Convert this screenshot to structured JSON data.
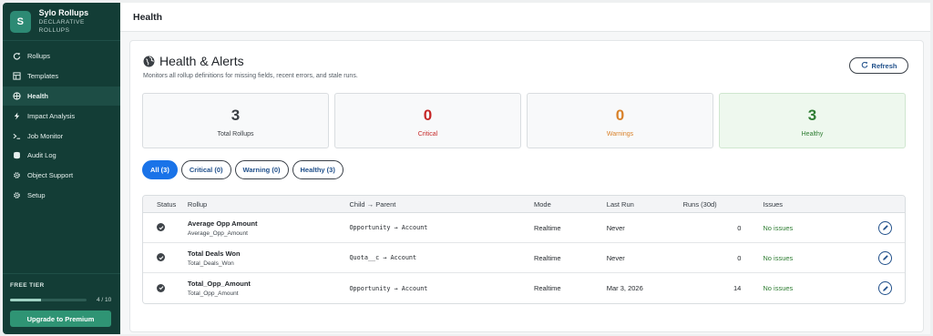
{
  "brand": {
    "logo_letter": "S",
    "name": "Sylo Rollups",
    "subtitle": "DECLARATIVE ROLLUPS"
  },
  "sidebar": {
    "items": [
      {
        "label": "Rollups",
        "icon": "refresh-icon",
        "active": false
      },
      {
        "label": "Templates",
        "icon": "template-icon",
        "active": false
      },
      {
        "label": "Health",
        "icon": "health-icon",
        "active": true
      },
      {
        "label": "Impact Analysis",
        "icon": "bolt-icon",
        "active": false
      },
      {
        "label": "Job Monitor",
        "icon": "terminal-icon",
        "active": false
      },
      {
        "label": "Audit Log",
        "icon": "database-icon",
        "active": false
      },
      {
        "label": "Object Support",
        "icon": "gear-icon",
        "active": false
      },
      {
        "label": "Setup",
        "icon": "gear-icon",
        "active": false
      }
    ],
    "footer": {
      "tier_label": "FREE TIER",
      "usage_text": "4 / 10",
      "usage_fraction": 0.4,
      "upgrade_label": "Upgrade to Premium"
    }
  },
  "header": {
    "title": "Health"
  },
  "main": {
    "title": "Health & Alerts",
    "subtitle": "Monitors all rollup definitions for missing fields, recent errors, and stale runs.",
    "refresh_label": "Refresh",
    "stats": [
      {
        "value": "3",
        "label": "Total Rollups",
        "color": "#3a3f44"
      },
      {
        "value": "0",
        "label": "Critical",
        "color": "#c62828"
      },
      {
        "value": "0",
        "label": "Warnings",
        "color": "#d9822b"
      },
      {
        "value": "3",
        "label": "Healthy",
        "color": "#2e7d32"
      }
    ],
    "filters": [
      {
        "label": "All (3)",
        "active": true
      },
      {
        "label": "Critical (0)",
        "active": false
      },
      {
        "label": "Warning (0)",
        "active": false
      },
      {
        "label": "Healthy (3)",
        "active": false
      }
    ],
    "table": {
      "headers": {
        "status": "Status",
        "rollup": "Rollup",
        "child": "Child → Parent",
        "mode": "Mode",
        "last_run": "Last Run",
        "runs": "Runs (30d)",
        "issues": "Issues"
      },
      "rows": [
        {
          "name": "Average Opp Amount",
          "api": "Average_Opp_Amount",
          "child": "Opportunity → Account",
          "mode": "Realtime",
          "last_run": "Never",
          "runs": "0",
          "issues": "No issues"
        },
        {
          "name": "Total Deals Won",
          "api": "Total_Deals_Won",
          "child": "Quota__c → Account",
          "mode": "Realtime",
          "last_run": "Never",
          "runs": "0",
          "issues": "No issues"
        },
        {
          "name": "Total_Opp_Amount",
          "api": "Total_Opp_Amount",
          "child": "Opportunity → Account",
          "mode": "Realtime",
          "last_run": "Mar 3, 2026",
          "runs": "14",
          "issues": "No issues"
        }
      ]
    }
  }
}
